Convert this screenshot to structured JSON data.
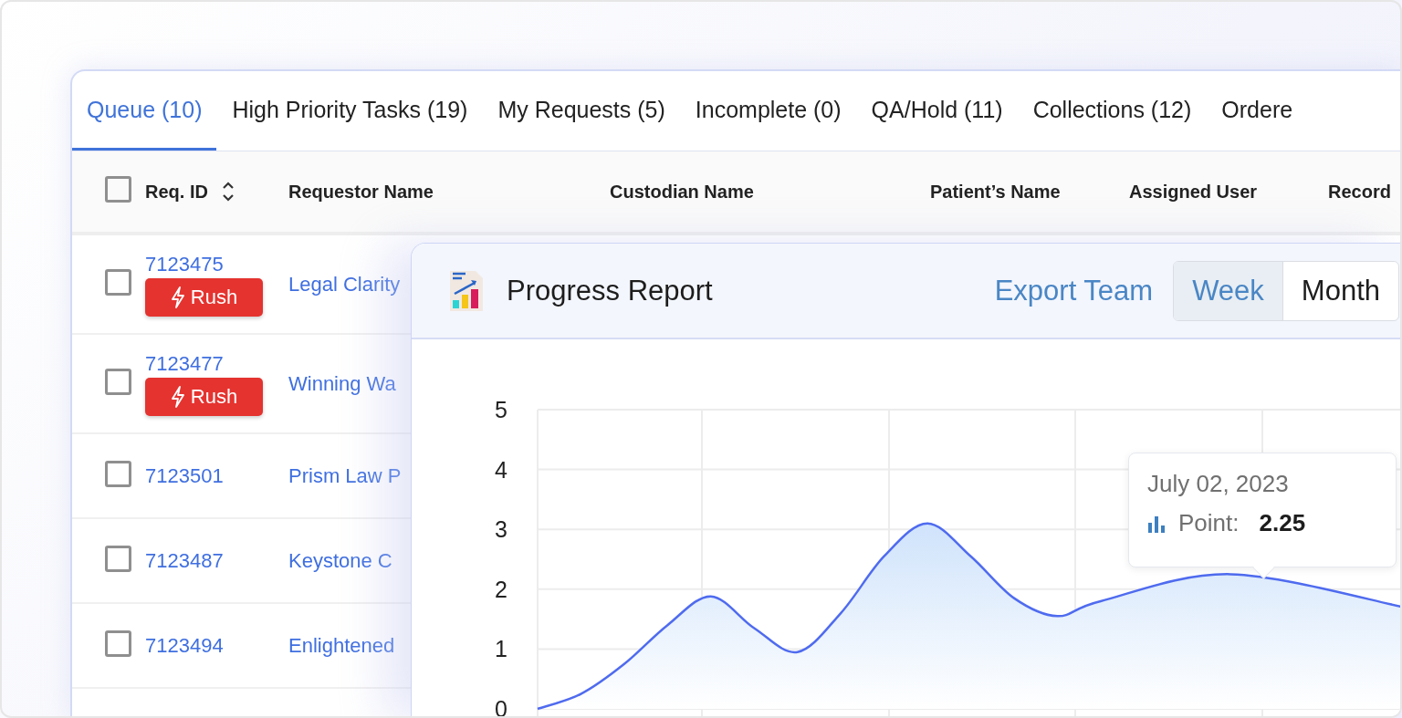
{
  "tabs": [
    {
      "label": "Queue (10)",
      "selected": true
    },
    {
      "label": "High Priority Tasks (19)",
      "selected": false
    },
    {
      "label": "My Requests (5)",
      "selected": false
    },
    {
      "label": "Incomplete (0)",
      "selected": false
    },
    {
      "label": "QA/Hold (11)",
      "selected": false
    },
    {
      "label": "Collections (12)",
      "selected": false
    },
    {
      "label": "Ordere",
      "selected": false
    }
  ],
  "table": {
    "select_all": {
      "checked": false
    },
    "columns": [
      {
        "label": "Req. ID",
        "sortable": true
      },
      {
        "label": "Requestor Name",
        "sortable": false
      },
      {
        "label": "Custodian Name",
        "sortable": false
      },
      {
        "label": "Patient’s Name",
        "sortable": false
      },
      {
        "label": "Assigned User",
        "sortable": false
      },
      {
        "label": "Record",
        "sortable": false
      }
    ],
    "rows": [
      {
        "checked": false,
        "req_id": "7123475",
        "rush": true,
        "rush_label": "Rush",
        "requestor": "Legal Clarity"
      },
      {
        "checked": false,
        "req_id": "7123477",
        "rush": true,
        "rush_label": "Rush",
        "requestor": "Winning Wa"
      },
      {
        "checked": false,
        "req_id": "7123501",
        "rush": false,
        "requestor": "Prism Law P"
      },
      {
        "checked": false,
        "req_id": "7123487",
        "rush": false,
        "requestor": "Keystone C"
      },
      {
        "checked": false,
        "req_id": "7123494",
        "rush": false,
        "requestor": "Enlightened"
      }
    ]
  },
  "progress_report": {
    "title": "Progress Report",
    "export_link": "Export Team",
    "periods": [
      {
        "label": "Week",
        "selected": true
      },
      {
        "label": "Month",
        "selected": false
      }
    ],
    "tooltip": {
      "date": "July 02, 2023",
      "label": "Point:",
      "value": "2.25"
    },
    "chart_data": {
      "type": "area",
      "grid": true,
      "categories": [
        null,
        null,
        null,
        null,
        null,
        null,
        null,
        null,
        null,
        null,
        null,
        null,
        null,
        null,
        null,
        null,
        null,
        null,
        null,
        null,
        null
      ],
      "ylim": [
        0,
        5
      ],
      "yticks": [
        0,
        1,
        2,
        3,
        4,
        5
      ],
      "series": [
        {
          "color": "#4f6bef",
          "values": [
            0,
            0.25,
            0.75,
            1.4,
            1.88,
            1.35,
            0.95,
            1.6,
            2.55,
            3.1,
            2.55,
            1.85,
            1.55,
            1.8,
            null,
            null,
            2.25,
            null,
            null,
            null,
            1.7
          ]
        }
      ]
    }
  }
}
